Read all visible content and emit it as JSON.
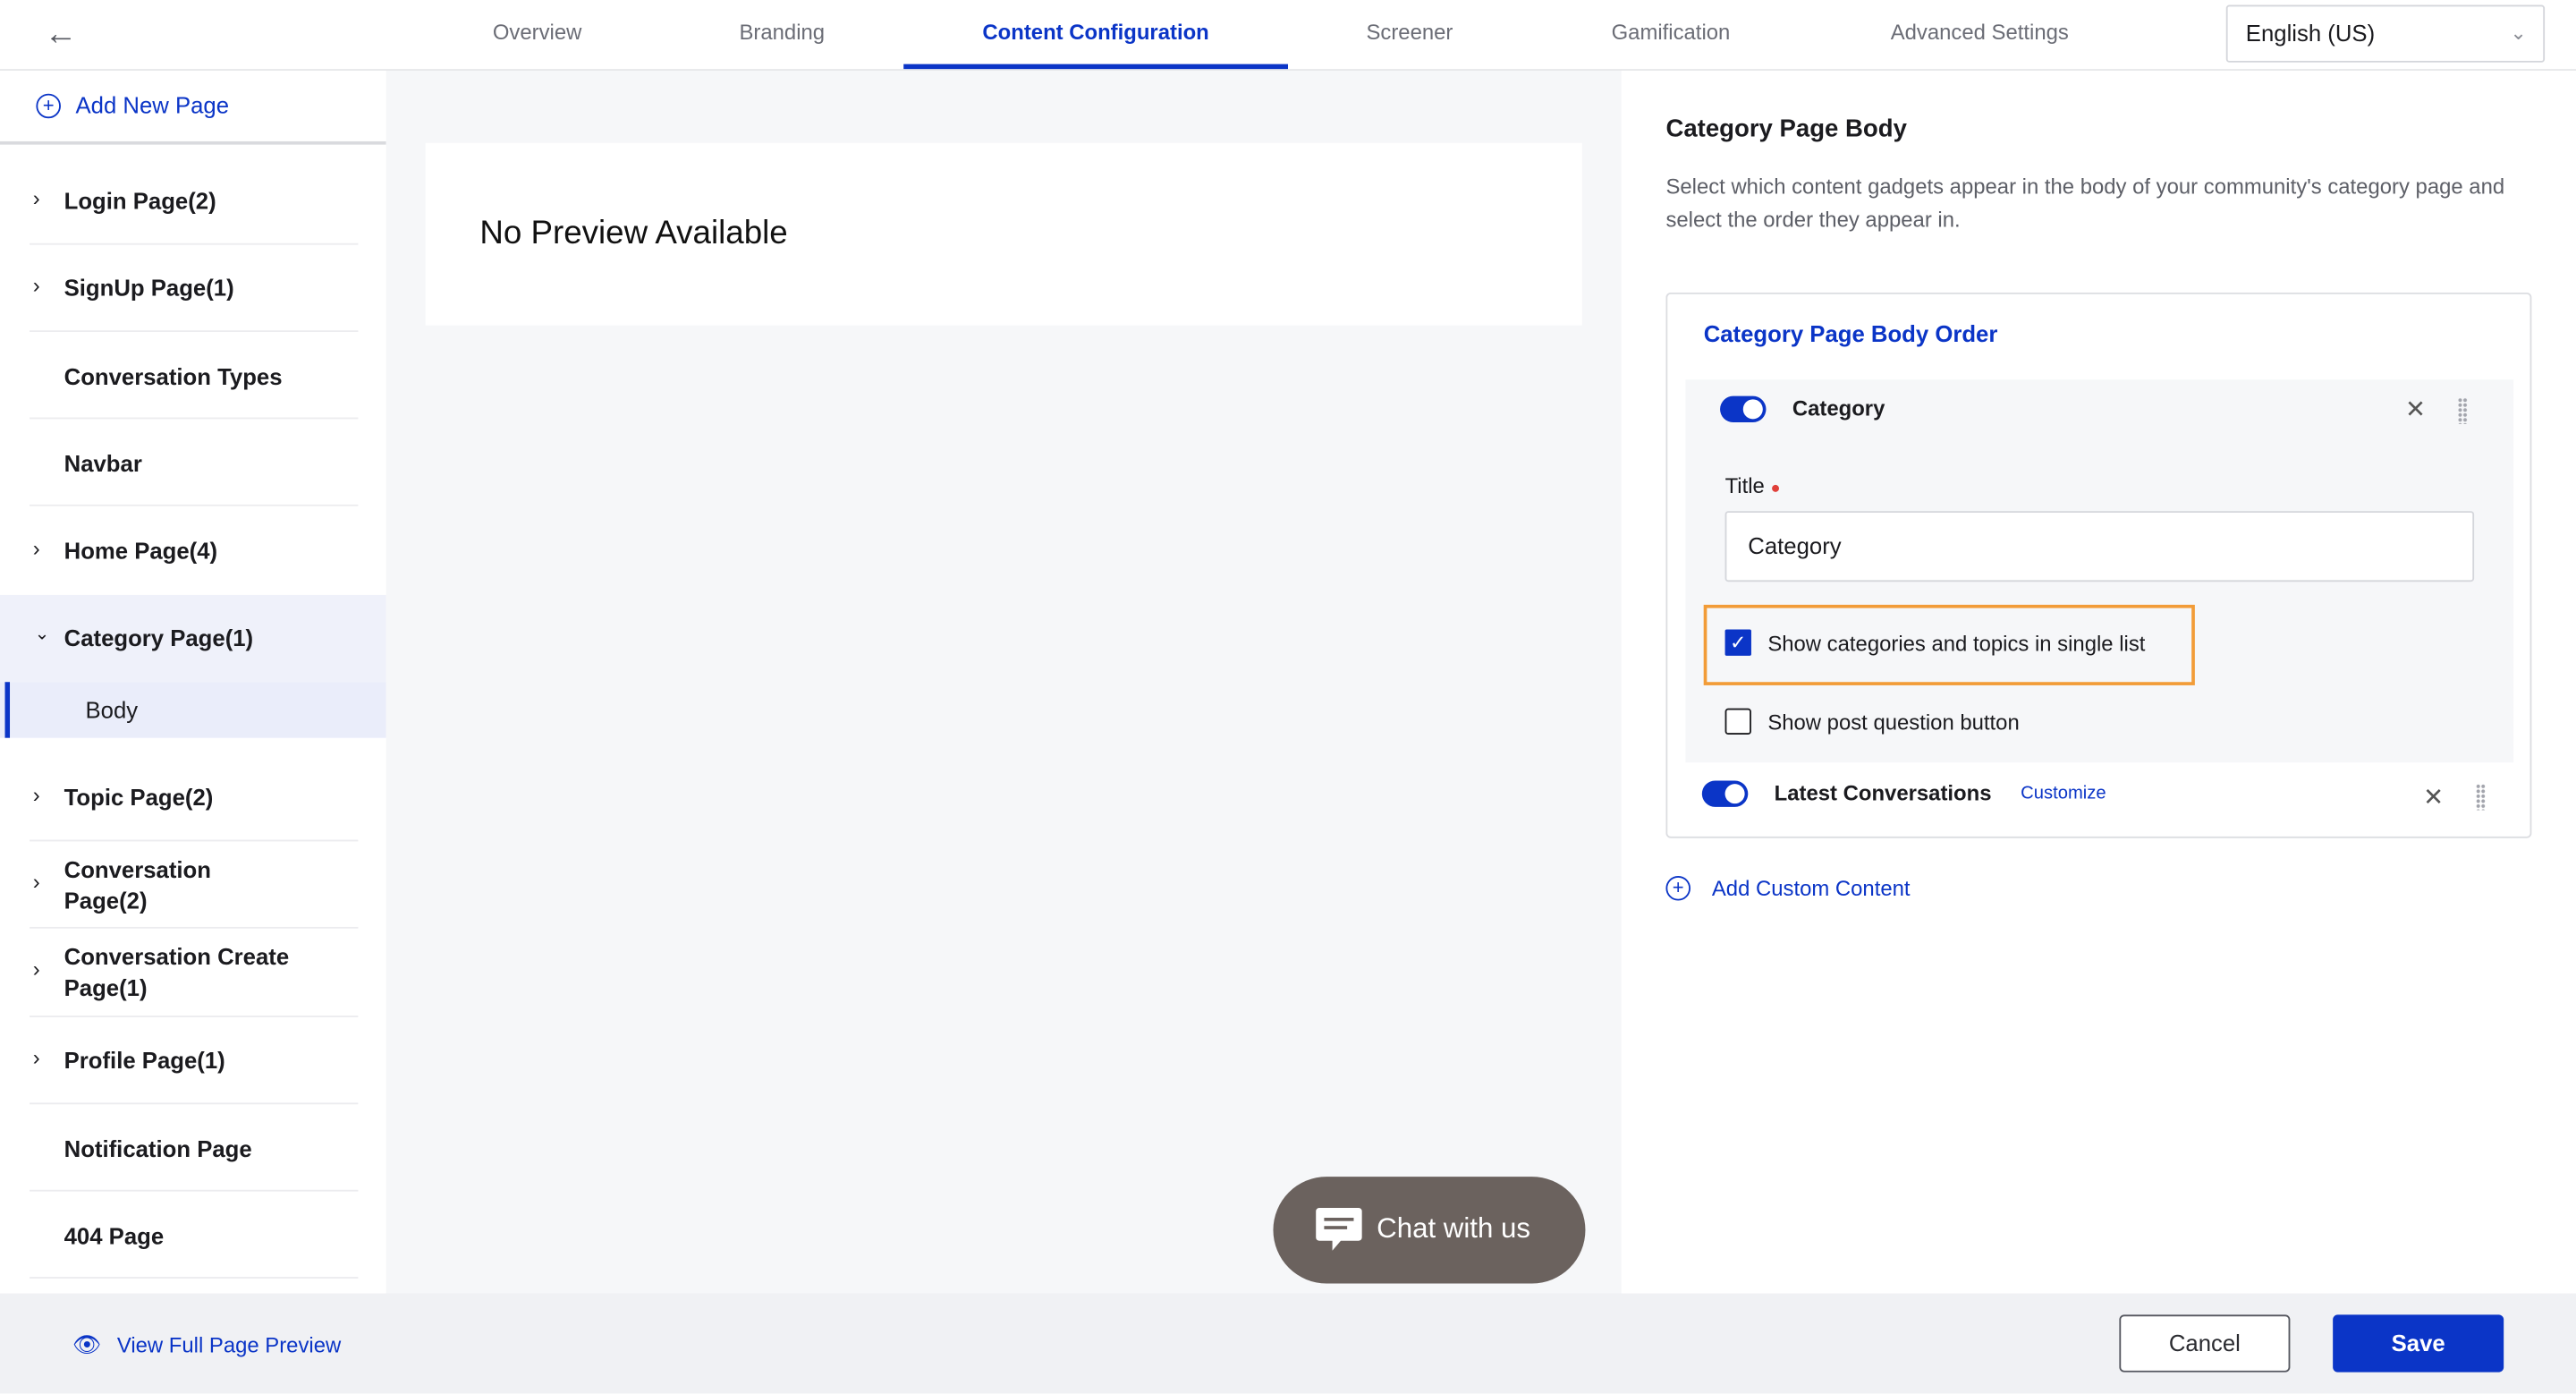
{
  "header": {
    "back_icon": "arrow-left-icon",
    "tabs": [
      {
        "label": "Overview",
        "active": false
      },
      {
        "label": "Branding",
        "active": false
      },
      {
        "label": "Content Configuration",
        "active": true
      },
      {
        "label": "Screener",
        "active": false
      },
      {
        "label": "Gamification",
        "active": false
      },
      {
        "label": "Advanced Settings",
        "active": false
      }
    ],
    "language": "English (US)"
  },
  "sidebar": {
    "add_new_page": "Add New Page",
    "items": [
      {
        "label": "Login Page(2)",
        "expandable": true
      },
      {
        "label": "SignUp Page(1)",
        "expandable": true
      },
      {
        "label": "Conversation Types",
        "expandable": false
      },
      {
        "label": "Navbar",
        "expandable": false
      },
      {
        "label": "Home Page(4)",
        "expandable": true
      },
      {
        "label": "Category Page(1)",
        "expandable": true,
        "expanded": true
      },
      {
        "label": "Body",
        "child": true,
        "selected": true
      },
      {
        "label": "Topic Page(2)",
        "expandable": true
      },
      {
        "label": "Conversation Page(2)",
        "expandable": true
      },
      {
        "label": "Conversation Create Page(1)",
        "expandable": true
      },
      {
        "label": "Profile Page(1)",
        "expandable": true
      },
      {
        "label": "Notification Page",
        "expandable": false
      },
      {
        "label": "404 Page",
        "expandable": false
      }
    ]
  },
  "preview": {
    "text": "No Preview Available"
  },
  "panel": {
    "heading": "Category Page Body",
    "description": "Select which content gadgets appear in the body of your community's category page and select the order they appear in.",
    "card_title": "Category Page Body Order",
    "gadgets": [
      {
        "name": "Category",
        "enabled": true,
        "title_label": "Title",
        "title_value": "Category",
        "options": [
          {
            "label": "Show categories and topics in single list",
            "checked": true,
            "highlighted": true
          },
          {
            "label": "Show post question button",
            "checked": false
          }
        ]
      },
      {
        "name": "Latest Conversations",
        "enabled": true,
        "customize": "Customize"
      }
    ],
    "add_custom_content": "Add Custom Content"
  },
  "footer": {
    "view_preview": "View Full Page Preview",
    "cancel": "Cancel",
    "save": "Save"
  },
  "chat": {
    "label": "Chat with us"
  },
  "colors": {
    "accent": "#0b35c7",
    "highlight": "#f29c38",
    "required": "#e0403a"
  }
}
